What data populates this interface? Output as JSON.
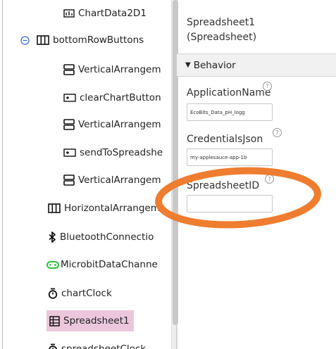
{
  "tree": {
    "items": [
      {
        "label": "ChartData2D1",
        "icon": "chart-data-icon"
      },
      {
        "label": "bottomRowButtons",
        "icon": "table-arrangement-icon"
      },
      {
        "label": "VerticalArrangem",
        "icon": "vertical-arrangement-icon"
      },
      {
        "label": "clearChartButton",
        "icon": "button-icon"
      },
      {
        "label": "VerticalArrangem",
        "icon": "vertical-arrangement-icon"
      },
      {
        "label": "sendToSpreadshe",
        "icon": "button-icon"
      },
      {
        "label": "VerticalArrangem",
        "icon": "vertical-arrangement-icon"
      },
      {
        "label": "HorizontalArrangem",
        "icon": "horizontal-arrangement-icon"
      },
      {
        "label": "BluetoothConnectio",
        "icon": "bluetooth-icon"
      },
      {
        "label": "MicrobitDataChanne",
        "icon": "microbit-icon"
      },
      {
        "label": "chartClock",
        "icon": "clock-icon"
      },
      {
        "label": "Spreadsheet1",
        "icon": "spreadsheet-icon"
      },
      {
        "label": "spreadsheetClock",
        "icon": "clock-icon"
      }
    ],
    "expander_symbol": "⊖"
  },
  "properties": {
    "title_line1": "Spreadsheet1",
    "title_line2": "(Spreadsheet)",
    "section": {
      "arrow": "▼",
      "label": "Behavior"
    },
    "help_symbol": "?",
    "fields": {
      "application_name": {
        "label": "ApplicationName",
        "value": "EcoBits_Data_pH_logg"
      },
      "credentials_json": {
        "label": "CredentialsJson",
        "value": "my-applesauce-app-1b"
      },
      "spreadsheet_id": {
        "label": "SpreadsheetID",
        "value": ""
      }
    }
  },
  "colors": {
    "selected_bg": "#ecc7dc",
    "highlight_oval": "#ef7d2f",
    "microbit_green": "#2fbf3f"
  }
}
